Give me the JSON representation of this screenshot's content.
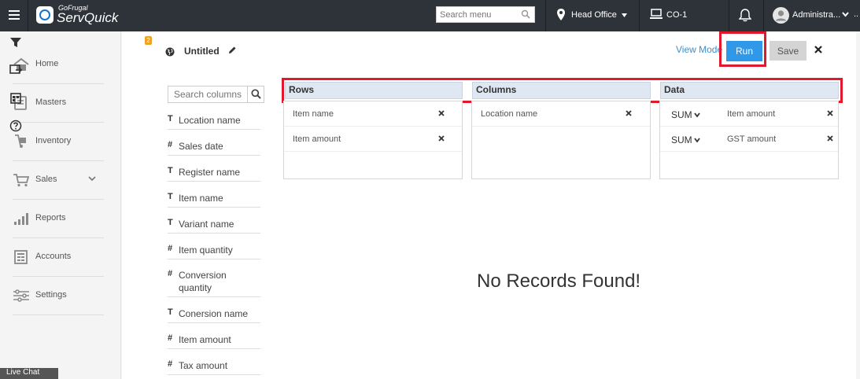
{
  "topbar": {
    "logo_small": "GoFrugal",
    "logo_big": "ServQuick",
    "search_placeholder": "Search menu",
    "location": "Head Office",
    "counter": "CO-1",
    "user": "Administra..."
  },
  "sidebar": {
    "items": [
      {
        "label": "Home",
        "icon": "home-icon"
      },
      {
        "label": "Masters",
        "icon": "book-icon"
      },
      {
        "label": "Inventory",
        "icon": "hand-truck-icon"
      },
      {
        "label": "Sales",
        "icon": "cart-icon"
      },
      {
        "label": "Reports",
        "icon": "bar-chart-icon"
      },
      {
        "label": "Accounts",
        "icon": "ledger-icon"
      },
      {
        "label": "Settings",
        "icon": "sliders-icon"
      }
    ],
    "bottom_tab": "Live Chat"
  },
  "toolstrip": {
    "filter_badge": "2",
    "tools": [
      "filter-icon",
      "chart-export-icon",
      "calendar-icon",
      "help-icon"
    ]
  },
  "report": {
    "title": "Untitled",
    "view_mode": "View Mode",
    "run_label": "Run",
    "save_label": "Save"
  },
  "columns_panel": {
    "search_placeholder": "Search columns",
    "items": [
      {
        "type": "T",
        "name": "Location name"
      },
      {
        "type": "#",
        "name": "Sales date"
      },
      {
        "type": "T",
        "name": "Register name"
      },
      {
        "type": "T",
        "name": "Item name"
      },
      {
        "type": "T",
        "name": "Variant name"
      },
      {
        "type": "#",
        "name": "Item quantity"
      },
      {
        "type": "#",
        "name": "Conversion quantity"
      },
      {
        "type": "T",
        "name": "Conersion name"
      },
      {
        "type": "#",
        "name": "Item amount"
      },
      {
        "type": "#",
        "name": "Tax amount"
      }
    ]
  },
  "zones": {
    "rows": {
      "header": "Rows",
      "items": [
        "Item name",
        "Item amount"
      ]
    },
    "columns": {
      "header": "Columns",
      "items": [
        "Location name"
      ]
    },
    "data": {
      "header": "Data",
      "items": [
        {
          "agg": "SUM",
          "field": "Item amount"
        },
        {
          "agg": "SUM",
          "field": "GST amount"
        }
      ]
    }
  },
  "empty_message": "No Records Found!",
  "colors": {
    "accent": "#2f98e8",
    "highlight": "#e0192c",
    "topbar": "#2e3339",
    "zone_header": "#dfe8f2"
  }
}
